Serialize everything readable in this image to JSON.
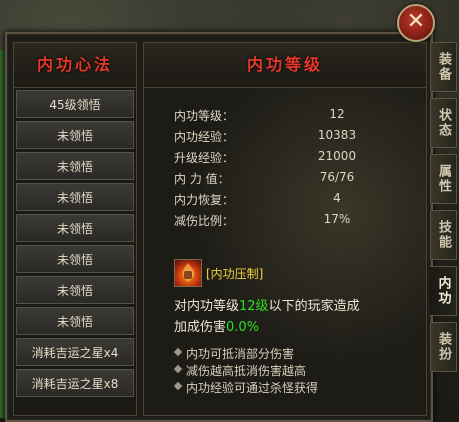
{
  "left_panel": {
    "title": "内功心法",
    "items": [
      "45级领悟",
      "未领悟",
      "未领悟",
      "未领悟",
      "未领悟",
      "未领悟",
      "未领悟",
      "未领悟",
      "消耗吉运之星x4",
      "消耗吉运之星x8"
    ]
  },
  "main_panel": {
    "title": "内功等级",
    "stats": [
      {
        "label": "内功等级：",
        "value": "12"
      },
      {
        "label": "内功经验：",
        "value": "10383"
      },
      {
        "label": "升级经验：",
        "value": "21000"
      },
      {
        "label": "内 力 值：",
        "value": "76/76"
      },
      {
        "label": "内力恢复：",
        "value": "4"
      },
      {
        "label": "减伤比例：",
        "value": "17%"
      }
    ],
    "skill": {
      "name": "[内功压制]",
      "icon": "fire-fist-icon"
    },
    "description": {
      "line1_prefix": "对内功等级",
      "line1_level": "12级",
      "line1_suffix": "以下的玩家造成",
      "line2_prefix": "加成伤害",
      "line2_value": "0.0%"
    },
    "bullets": [
      "内功可抵消部分伤害",
      "减伤越高抵消伤害越高",
      "内功经验可通过杀怪获得"
    ]
  },
  "tabs": [
    {
      "label": "装备",
      "active": false
    },
    {
      "label": "状态",
      "active": false
    },
    {
      "label": "属性",
      "active": false
    },
    {
      "label": "技能",
      "active": false
    },
    {
      "label": "内功",
      "active": true
    },
    {
      "label": "装扮",
      "active": false
    }
  ],
  "close_icon": "close-icon",
  "colors": {
    "header_red": "#e6382a",
    "highlight_green": "#2ee01e",
    "skill_yellow": "#f2d23c"
  }
}
